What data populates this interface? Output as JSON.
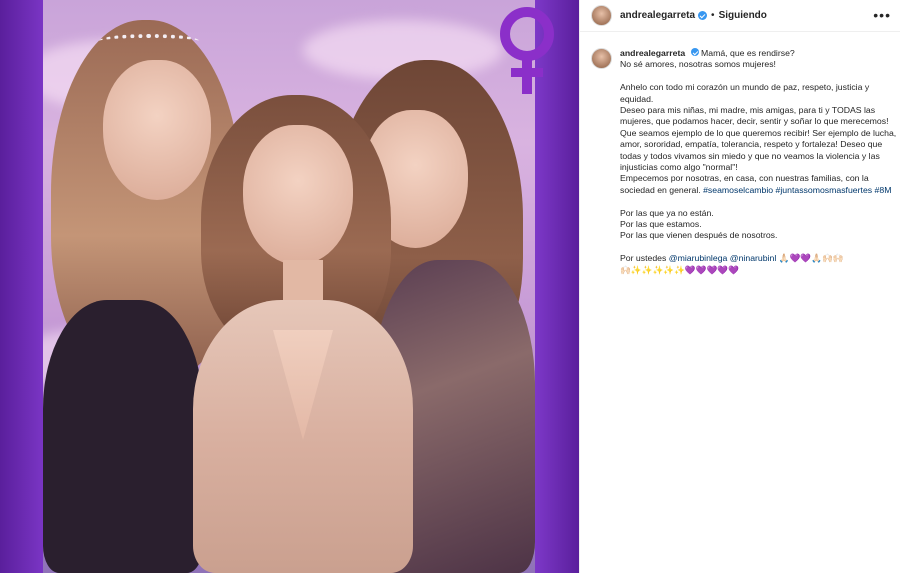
{
  "post": {
    "username": "andrealegarreta",
    "follow_status": "Siguiendo",
    "separator": "•",
    "more_label": "•••"
  },
  "caption": {
    "first_line": "Mamá, que es rendirse?",
    "line_2": "No sé amores, nosotras somos mujeres!",
    "para_1": "Anhelo con todo mi corazón un mundo de paz, respeto, justicia y equidad.",
    "para_2": "Deseo para mis niñas, mi madre, mis amigas, para ti y TODAS las mujeres, que podamos hacer, decir, sentir y soñar lo que merecemos! Que seamos ejemplo de lo que queremos recibir! Ser ejemplo de lucha, amor, sororidad, empatía, tolerancia, respeto y fortaleza! Deseo que todas y todos vivamos sin miedo y que no veamos la violencia y las injusticias como algo \"normal\"!",
    "para_3": "Empecemos por nosotras, en casa, con nuestras familias, con la sociedad en general.",
    "hashtag_1": "#seamoselcambio",
    "hashtag_2": "#juntassomosmasfuertes",
    "hashtag_3": "#8M",
    "closing_1": "Por las que ya no están.",
    "closing_2": "Por las que estamos.",
    "closing_3": "Por las que vienen después de nosotros.",
    "mention_prefix": "Por ustedes",
    "mention_1": "@miarubinlega",
    "mention_2": "@ninarubinl",
    "emoji_1": "🙏🏻💜💜🙏🏻🙌🏻🙌🏻",
    "emoji_2": "🙌🏻✨✨✨✨✨💜💜💜💜💜"
  },
  "colors": {
    "link": "#00376b",
    "frame_purple": "#6a2bb5",
    "symbol_purple": "#8b2fc9",
    "verified_blue": "#3897f0"
  },
  "icons": {
    "venus_symbol": "venus-icon",
    "verified": "verified-badge-icon",
    "more": "more-options-icon"
  }
}
